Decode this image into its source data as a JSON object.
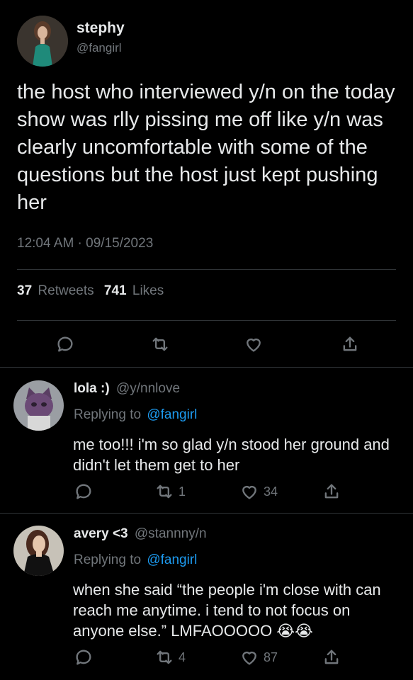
{
  "main_tweet": {
    "author_name": "stephy",
    "author_handle": "@fangirl",
    "text": "the host who interviewed y/n on the today show was rlly pissing me off like y/n was clearly uncomfortable with some of the questions but the host just kept pushing her",
    "timestamp": "12:04 AM · 09/15/2023",
    "retweets_count": "37",
    "retweets_label": "Retweets",
    "likes_count": "741",
    "likes_label": "Likes"
  },
  "replies": [
    {
      "author_name": "lola :)",
      "author_handle": "@y/nnlove",
      "replying_prefix": "Replying to",
      "replying_to": "@fangirl",
      "text": "me too!!! i'm so glad y/n stood her ground and didn't let them get to her",
      "retweets": "1",
      "likes": "34"
    },
    {
      "author_name": "avery <3",
      "author_handle": "@stannny/n",
      "replying_prefix": "Replying to",
      "replying_to": "@fangirl",
      "text": "when she said “the people i'm close with can reach me anytime. i tend to not focus on anyone else.” LMFAOOOOO",
      "emoji": "😭😭",
      "retweets": "4",
      "likes": "87"
    }
  ],
  "colors": {
    "background": "#000000",
    "text": "#e7e9ea",
    "muted": "#71767b",
    "link": "#1d9bf0",
    "divider": "#2f3336"
  }
}
